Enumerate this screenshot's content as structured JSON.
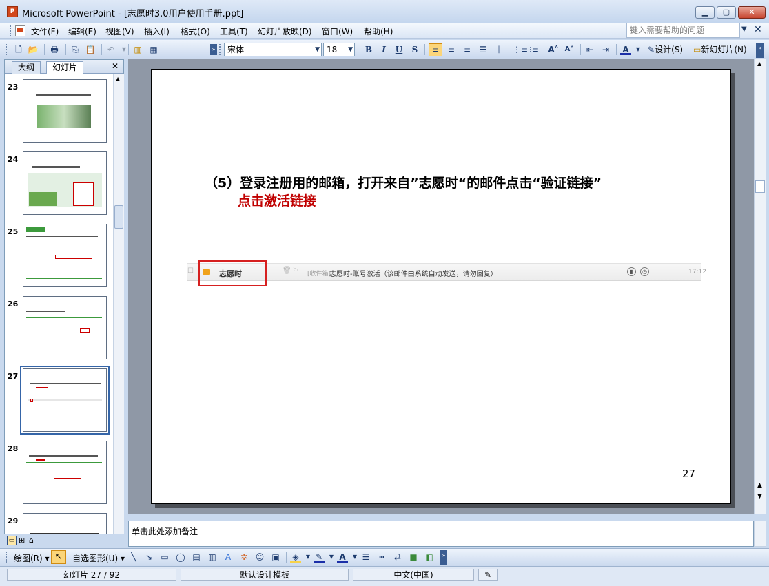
{
  "window": {
    "title": "Microsoft PowerPoint - [志愿时3.0用户使用手册.ppt]",
    "app_icon_label": "P"
  },
  "menu": {
    "items": [
      "文件(F)",
      "编辑(E)",
      "视图(V)",
      "插入(I)",
      "格式(O)",
      "工具(T)",
      "幻灯片放映(D)",
      "窗口(W)",
      "帮助(H)"
    ],
    "help_placeholder": "键入需要帮助的问题"
  },
  "toolbar": {
    "font_name": "宋体",
    "font_size": "18",
    "design_label": "设计(S)",
    "new_slide_label": "新幻灯片(N)",
    "bold": "B",
    "italic": "I",
    "underline": "U",
    "shadow": "S"
  },
  "panel": {
    "tab_outline": "大纲",
    "tab_slides": "幻灯片",
    "thumbnails": [
      {
        "num": "23"
      },
      {
        "num": "24"
      },
      {
        "num": "25"
      },
      {
        "num": "26"
      },
      {
        "num": "27",
        "selected": true
      },
      {
        "num": "28"
      },
      {
        "num": "29"
      }
    ]
  },
  "slide": {
    "title": "（5）登录注册用的邮箱，打开来自”志愿时“的邮件点击“验证链接”",
    "subtitle": "点击激活链接",
    "email": {
      "sender": "志愿时",
      "folder": "[收件箱]",
      "subject": "志愿时-账号激活（该邮件由系统自动发送，请勿回复）",
      "time": "17:12"
    },
    "page_number": "27"
  },
  "notes": {
    "placeholder": "单击此处添加备注"
  },
  "drawing": {
    "draw_label": "绘图(R)",
    "autoshapes_label": "自选图形(U)"
  },
  "status": {
    "slide_position": "幻灯片 27 / 92",
    "template": "默认设计模板",
    "language": "中文(中国)"
  },
  "colors": {
    "accent_red": "#c00000",
    "highlight_box": "#d62020",
    "selection_blue": "#3565a8"
  }
}
